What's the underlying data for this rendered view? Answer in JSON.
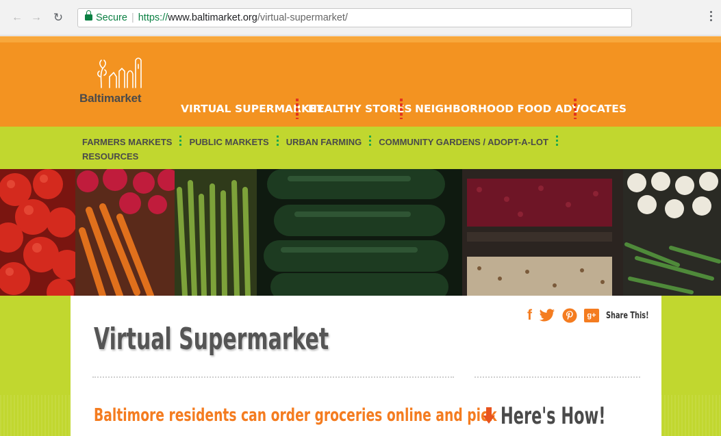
{
  "browser": {
    "back_icon": "arrow-left-icon",
    "forward_icon": "arrow-right-icon",
    "reload_icon": "reload-icon",
    "secure_label": "Secure",
    "url_scheme": "https://",
    "url_host": "www.baltimarket.org",
    "url_path": "/virtual-supermarket/",
    "menu_icon": "kebab-menu-icon"
  },
  "header": {
    "logo_text": "Baltimarket",
    "main_nav": [
      "VIRTUAL SUPERMARKET",
      "HEALTHY STORES",
      "NEIGHBORHOOD FOOD ADVOCATES"
    ]
  },
  "subnav": {
    "items": [
      "FARMERS MARKETS",
      "PUBLIC MARKETS",
      "URBAN FARMING",
      "COMMUNITY GARDENS / ADOPT-A-LOT",
      "RESOURCES"
    ]
  },
  "hero": {
    "image": "produce-banner-image"
  },
  "content": {
    "share": {
      "icons": [
        "facebook-icon",
        "twitter-icon",
        "pinterest-icon",
        "google-plus-icon"
      ],
      "gplus_glyph": "g+",
      "label": "Share This!"
    },
    "title": "Virtual Supermarket",
    "subheading": "Baltimore residents can order groceries online and pick",
    "heres_how": "Here's How!"
  },
  "colors": {
    "header_orange": "#f39321",
    "subnav_green": "#c1d72f",
    "accent_orange": "#f47c20",
    "divider_red": "#e2331f",
    "divider_green": "#1fa84a"
  }
}
